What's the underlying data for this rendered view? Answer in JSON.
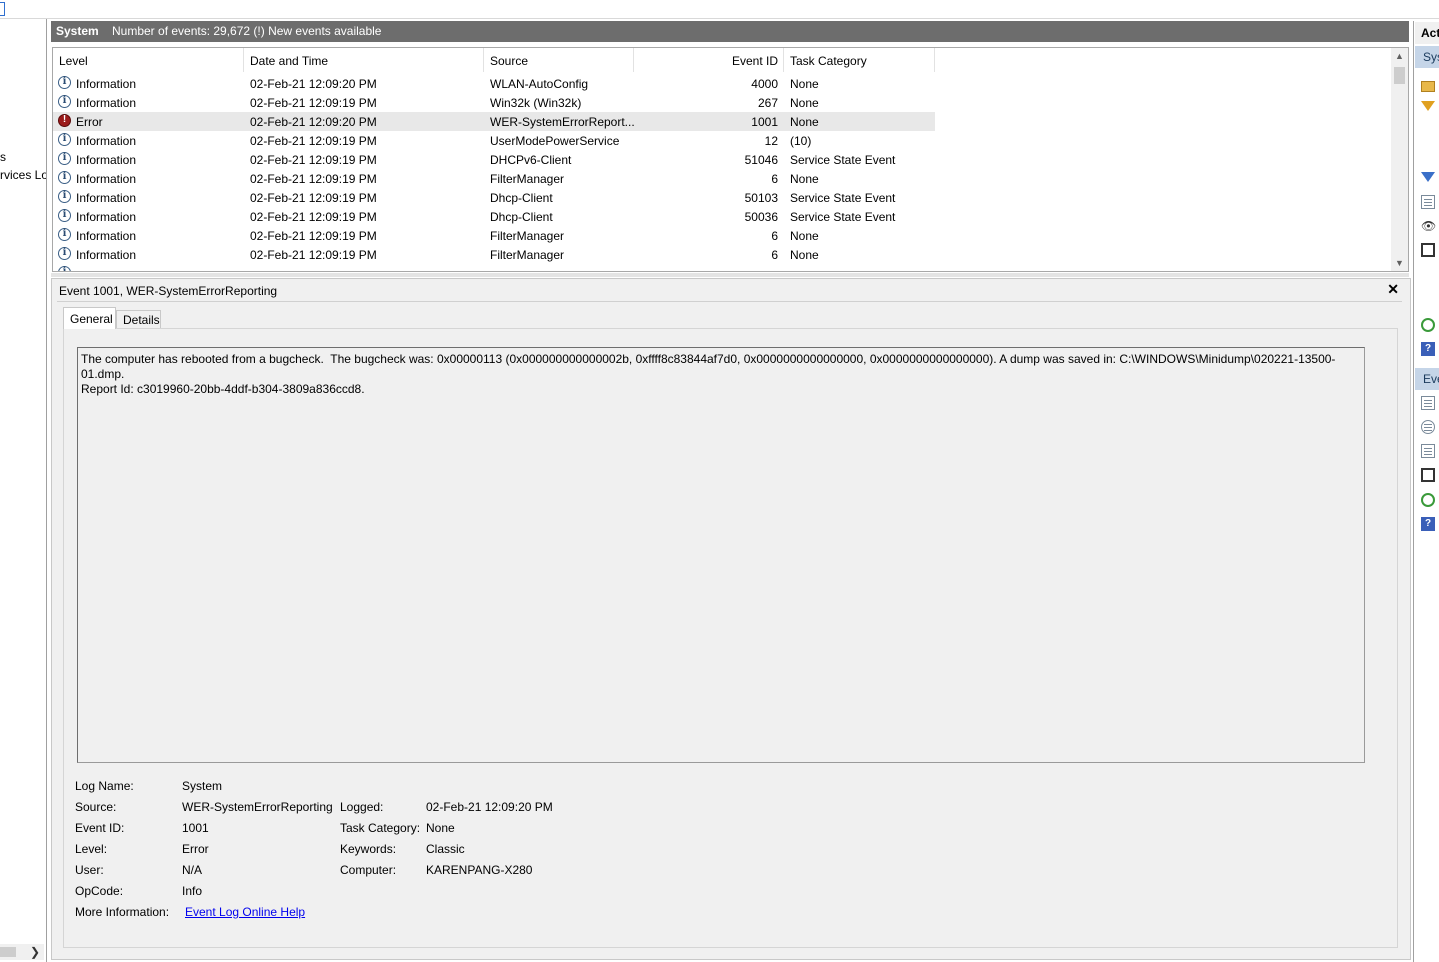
{
  "left_tree": {
    "items": [
      "s",
      "rvices Lo"
    ]
  },
  "header": {
    "title": "System",
    "event_count": "Number of events: 29,672 (!) New events available"
  },
  "events_table": {
    "columns": [
      "Level",
      "Date and Time",
      "Source",
      "Event ID",
      "Task Category"
    ],
    "rows": [
      {
        "level": "Information",
        "date": "02-Feb-21 12:09:20 PM",
        "source": "WLAN-AutoConfig",
        "event_id": "4000",
        "category": "None"
      },
      {
        "level": "Information",
        "date": "02-Feb-21 12:09:19 PM",
        "source": "Win32k (Win32k)",
        "event_id": "267",
        "category": "None"
      },
      {
        "level": "Error",
        "date": "02-Feb-21 12:09:20 PM",
        "source": "WER-SystemErrorReport...",
        "event_id": "1001",
        "category": "None"
      },
      {
        "level": "Information",
        "date": "02-Feb-21 12:09:19 PM",
        "source": "UserModePowerService",
        "event_id": "12",
        "category": "(10)"
      },
      {
        "level": "Information",
        "date": "02-Feb-21 12:09:19 PM",
        "source": "DHCPv6-Client",
        "event_id": "51046",
        "category": "Service State Event"
      },
      {
        "level": "Information",
        "date": "02-Feb-21 12:09:19 PM",
        "source": "FilterManager",
        "event_id": "6",
        "category": "None"
      },
      {
        "level": "Information",
        "date": "02-Feb-21 12:09:19 PM",
        "source": "Dhcp-Client",
        "event_id": "50103",
        "category": "Service State Event"
      },
      {
        "level": "Information",
        "date": "02-Feb-21 12:09:19 PM",
        "source": "Dhcp-Client",
        "event_id": "50036",
        "category": "Service State Event"
      },
      {
        "level": "Information",
        "date": "02-Feb-21 12:09:19 PM",
        "source": "FilterManager",
        "event_id": "6",
        "category": "None"
      },
      {
        "level": "Information",
        "date": "02-Feb-21 12:09:19 PM",
        "source": "FilterManager",
        "event_id": "6",
        "category": "None"
      }
    ],
    "selected_index": 2
  },
  "detail": {
    "title": "Event 1001, WER-SystemErrorReporting",
    "close_glyph": "✕",
    "tabs": [
      "General",
      "Details"
    ],
    "message": "The computer has rebooted from a bugcheck.  The bugcheck was: 0x00000113 (0x000000000000002b, 0xffff8c83844af7d0, 0x0000000000000000, 0x0000000000000000). A dump was saved in: C:\\WINDOWS\\Minidump\\020221-13500-01.dmp.\nReport Id: c3019960-20bb-4ddf-b304-3809a836ccd8.",
    "fields": {
      "log_name_label": "Log Name:",
      "log_name": "System",
      "source_label": "Source:",
      "source": "WER-SystemErrorReporting",
      "logged_label": "Logged:",
      "logged": "02-Feb-21 12:09:20 PM",
      "event_id_label": "Event ID:",
      "event_id": "1001",
      "task_category_label": "Task Category:",
      "task_category": "None",
      "level_label": "Level:",
      "level": "Error",
      "keywords_label": "Keywords:",
      "keywords": "Classic",
      "user_label": "User:",
      "user": "N/A",
      "computer_label": "Computer:",
      "computer": "KARENPANG-X280",
      "opcode_label": "OpCode:",
      "opcode": "Info",
      "more_info_label": "More Information:",
      "more_info_link": "Event Log Online Help"
    }
  },
  "actions_pane": {
    "header": "Act",
    "section_system": "Sys",
    "section_event": "Eve"
  }
}
